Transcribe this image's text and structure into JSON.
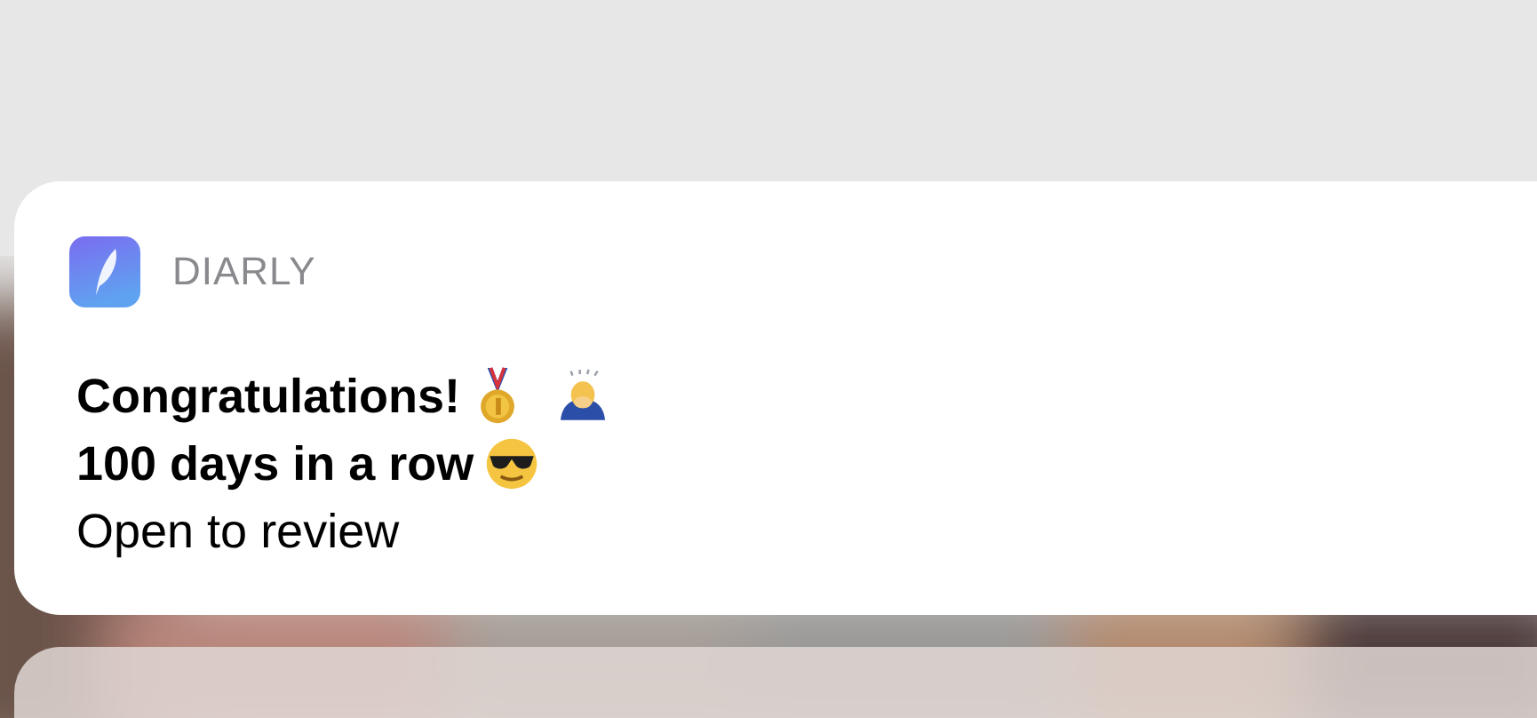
{
  "notification": {
    "app_name": "DIARLY",
    "title": "Congratulations!",
    "subtitle": "100 days in a row",
    "body": "Open to review"
  }
}
